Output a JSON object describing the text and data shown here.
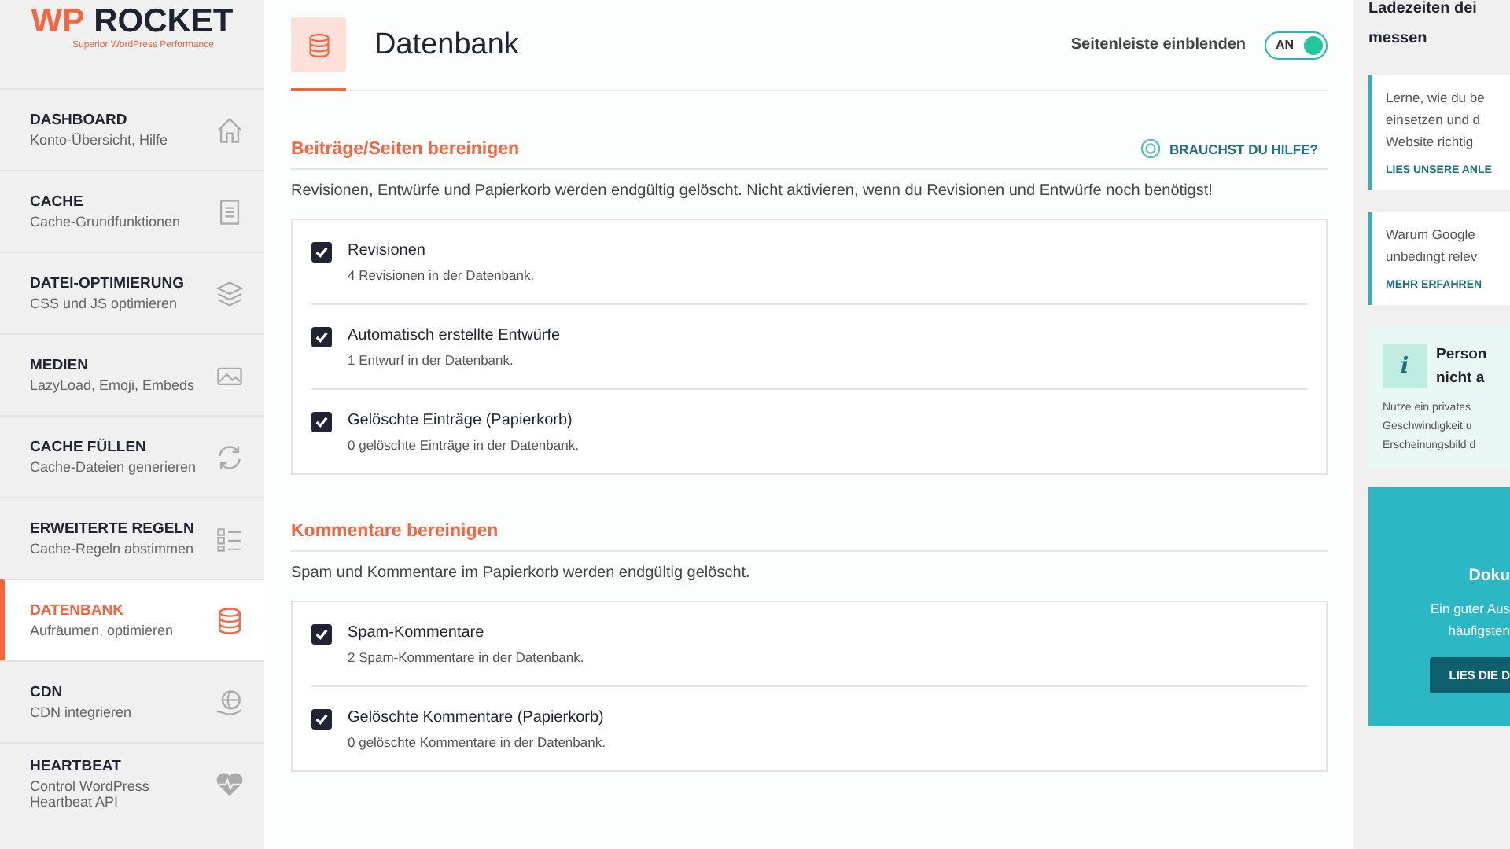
{
  "logo": {
    "brand_prefix": "WP",
    "brand_name": "ROCKET",
    "tagline": "Superior WordPress Performance"
  },
  "nav": [
    {
      "title": "DASHBOARD",
      "subtitle": "Konto-Übersicht, Hilfe",
      "kind": "home",
      "selected": false
    },
    {
      "title": "CACHE",
      "subtitle": "Cache-Grundfunktionen",
      "kind": "document",
      "selected": false
    },
    {
      "title": "DATEI-OPTIMIERUNG",
      "subtitle": "CSS und JS optimieren",
      "kind": "layers",
      "selected": false
    },
    {
      "title": "MEDIEN",
      "subtitle": "LazyLoad, Emoji, Embeds",
      "kind": "images",
      "selected": false
    },
    {
      "title": "CACHE FÜLLEN",
      "subtitle": "Cache-Dateien generieren",
      "kind": "refresh",
      "selected": false
    },
    {
      "title": "ERWEITERTE REGELN",
      "subtitle": "Cache-Regeln abstimmen",
      "kind": "list",
      "selected": false
    },
    {
      "title": "DATENBANK",
      "subtitle": "Aufräumen, optimieren",
      "kind": "database",
      "selected": true
    },
    {
      "title": "CDN",
      "subtitle": "CDN integrieren",
      "kind": "globe",
      "selected": false
    },
    {
      "title": "HEARTBEAT",
      "subtitle": "Control WordPress Heartbeat API",
      "kind": "heart",
      "selected": false
    }
  ],
  "header": {
    "title": "Datenbank",
    "sidebar_toggle": {
      "label": "Seitenleiste einblenden",
      "state_text": "AN",
      "on": true
    }
  },
  "sections": [
    {
      "title": "Beiträge/Seiten bereinigen",
      "help_link": "BRAUCHST DU HILFE?",
      "description": "Revisionen, Entwürfe und Papierkorb werden endgültig gelöscht. Nicht aktivieren, wenn du Revisionen und Entwürfe noch benötigst!",
      "options": [
        {
          "label": "Revisionen",
          "detail": "4 Revisionen in der Datenbank.",
          "checked": true
        },
        {
          "label": "Automatisch erstellte Entwürfe",
          "detail": "1 Entwurf in der Datenbank.",
          "checked": true
        },
        {
          "label": "Gelöschte Einträge (Papierkorb)",
          "detail": "0 gelöschte Einträge in der Datenbank.",
          "checked": true
        }
      ]
    },
    {
      "title": "Kommentare bereinigen",
      "description": "Spam und Kommentare im Papierkorb werden endgültig gelöscht.",
      "options": [
        {
          "label": "Spam-Kommentare",
          "detail": "2 Spam-Kommentare in der Datenbank.",
          "checked": true
        },
        {
          "label": "Gelöschte Kommentare (Papierkorb)",
          "detail": "0 gelöschte Kommentare in der Datenbank.",
          "checked": true
        }
      ]
    }
  ],
  "right_panel": {
    "heading_lines": [
      "Ladezeiten dei",
      "messen"
    ],
    "tip_cards": [
      {
        "lines": [
          "Lerne, wie du be",
          "einsetzen und d",
          "Website richtig"
        ],
        "link": "LIES UNSERE ANLE"
      },
      {
        "lines": [
          "Warum Google",
          "unbedingt relev"
        ],
        "link": "MEHR ERFAHREN"
      }
    ],
    "info_box": {
      "icon_text": "i",
      "title_lines": [
        "Person",
        "nicht a"
      ],
      "body_lines": [
        "Nutze ein privates",
        "Geschwindigkeit u",
        "Erscheinungsbild d"
      ]
    },
    "doc_card": {
      "title": "Doku",
      "body_lines": [
        "Ein guter Aus",
        "häufigsten"
      ],
      "button": "LIES DIE D"
    }
  }
}
